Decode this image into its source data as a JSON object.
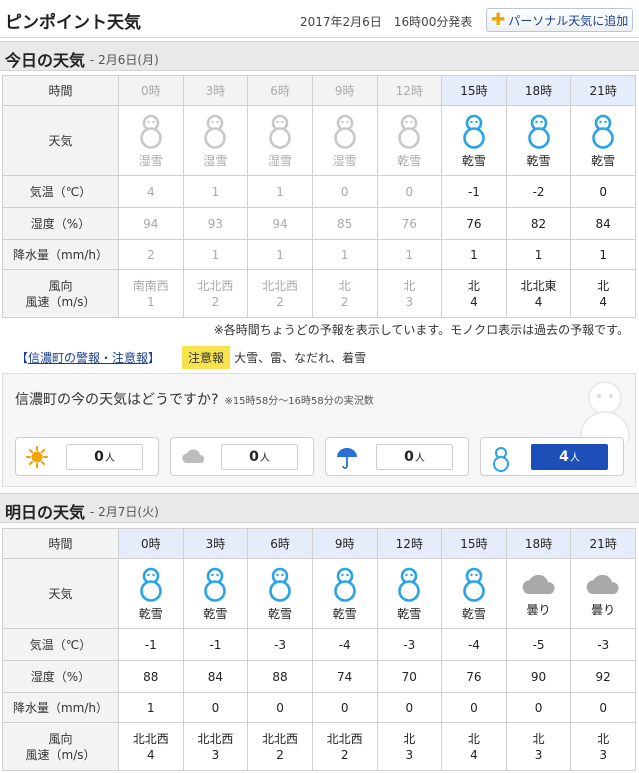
{
  "header": {
    "title": "ピンポイント天気",
    "issued": "2017年2月6日　16時00分発表",
    "personal_button": "パーソナル天気に追加"
  },
  "today": {
    "title": "今日の天気",
    "date": "- 2月6日(月)",
    "labels": {
      "hour": "時間",
      "weather": "天気",
      "temp": "気温（℃）",
      "humidity": "湿度（%）",
      "precip": "降水量（mm/h）",
      "wind_dir": "風向",
      "wind_speed": "風速（m/s）"
    },
    "hours": [
      "0時",
      "3時",
      "6時",
      "9時",
      "12時",
      "15時",
      "18時",
      "21時"
    ],
    "weather": [
      "湿雪",
      "湿雪",
      "湿雪",
      "湿雪",
      "乾雪",
      "乾雪",
      "乾雪",
      "乾雪"
    ],
    "weather_icons": [
      "snowman-icon",
      "snowman-icon",
      "snowman-icon",
      "snowman-icon",
      "snowman-icon",
      "snowman-icon",
      "snowman-icon",
      "snowman-icon"
    ],
    "temp": [
      "4",
      "1",
      "1",
      "0",
      "0",
      "-1",
      "-2",
      "0"
    ],
    "humidity": [
      "94",
      "93",
      "94",
      "85",
      "76",
      "76",
      "82",
      "84"
    ],
    "precip": [
      "2",
      "1",
      "1",
      "1",
      "1",
      "1",
      "1",
      "1"
    ],
    "wind_dir": [
      "南南西",
      "北北西",
      "北北西",
      "北",
      "北",
      "北",
      "北北東",
      "北"
    ],
    "wind_speed": [
      "1",
      "2",
      "2",
      "2",
      "3",
      "4",
      "4",
      "4"
    ]
  },
  "note": "※各時間ちょうどの予報を表示しています。モノクロ表示は過去の予報です。",
  "warning": {
    "bracket_open": "【",
    "link": "信濃町の警報・注意報",
    "bracket_close": "】",
    "tag": "注意報",
    "items": "大雪、雷、なだれ、着雪"
  },
  "now_poll": {
    "question": "信濃町の今の天気はどうですか?",
    "period": "※15時58分～16時58分の実況数",
    "unit": "人",
    "options": [
      {
        "icon": "sun-icon",
        "count": "0"
      },
      {
        "icon": "cloud-icon",
        "count": "0"
      },
      {
        "icon": "umbrella-icon",
        "count": "0"
      },
      {
        "icon": "snowman-icon",
        "count": "4"
      }
    ]
  },
  "tomorrow": {
    "title": "明日の天気",
    "date": "- 2月7日(火)",
    "labels": {
      "hour": "時間",
      "weather": "天気",
      "temp": "気温（℃）",
      "humidity": "湿度（%）",
      "precip": "降水量（mm/h）",
      "wind_dir": "風向",
      "wind_speed": "風速（m/s）"
    },
    "hours": [
      "0時",
      "3時",
      "6時",
      "9時",
      "12時",
      "15時",
      "18時",
      "21時"
    ],
    "weather": [
      "乾雪",
      "乾雪",
      "乾雪",
      "乾雪",
      "乾雪",
      "乾雪",
      "曇り",
      "曇り"
    ],
    "weather_icons": [
      "snowman-icon",
      "snowman-icon",
      "snowman-icon",
      "snowman-icon",
      "snowman-icon",
      "snowman-icon",
      "cloud-icon",
      "cloud-icon"
    ],
    "temp": [
      "-1",
      "-1",
      "-3",
      "-4",
      "-3",
      "-4",
      "-5",
      "-3"
    ],
    "humidity": [
      "88",
      "84",
      "88",
      "74",
      "70",
      "76",
      "90",
      "92"
    ],
    "precip": [
      "1",
      "0",
      "0",
      "0",
      "0",
      "0",
      "0",
      "0"
    ],
    "wind_dir": [
      "北北西",
      "北北西",
      "北北西",
      "北北西",
      "北",
      "北",
      "北",
      "北"
    ],
    "wind_speed": [
      "4",
      "3",
      "2",
      "2",
      "3",
      "4",
      "3",
      "3"
    ]
  },
  "colors": {
    "accent_blue": "#29a3e6",
    "past_gray": "#aaaaaa",
    "future_header": "#e5ecfa",
    "warning_tag": "#f7e34d"
  }
}
